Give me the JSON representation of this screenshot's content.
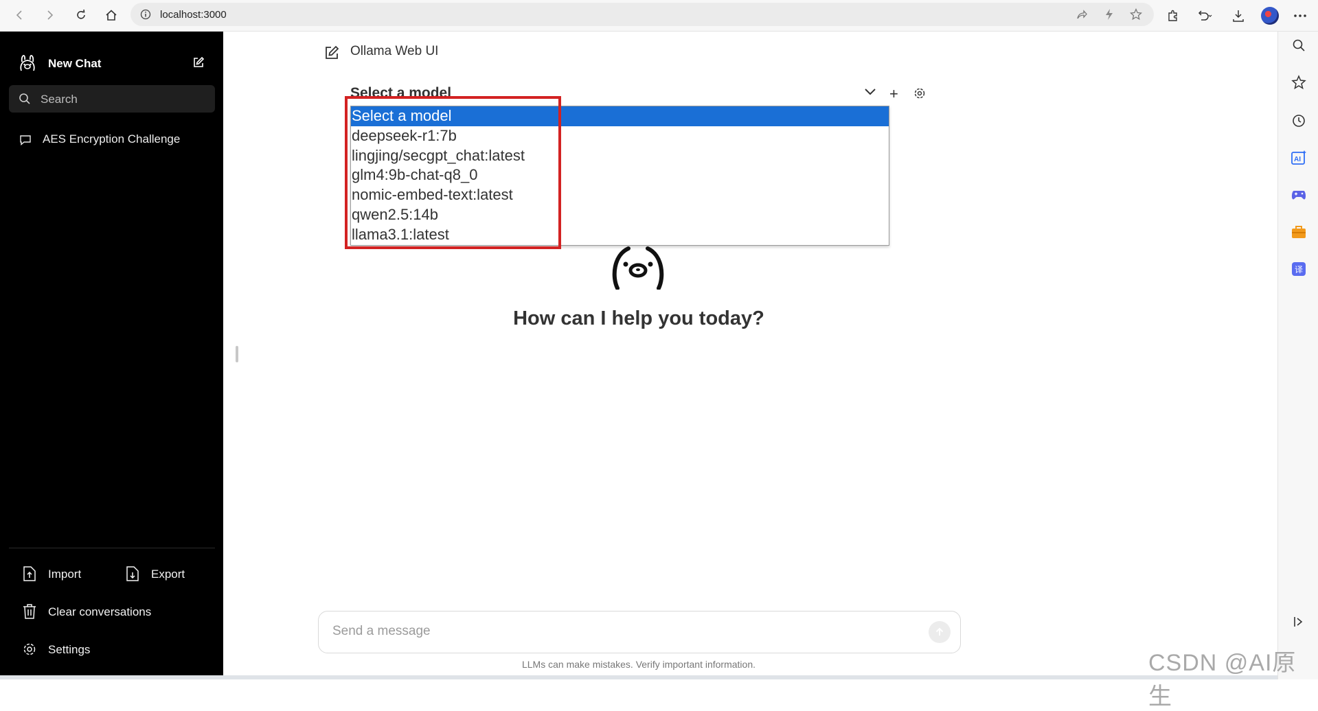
{
  "browser": {
    "url": "localhost:3000"
  },
  "sidebar": {
    "new_chat_label": "New Chat",
    "search_placeholder": "Search",
    "chats": [
      {
        "title": "AES Encryption Challenge"
      }
    ],
    "actions": {
      "import_label": "Import",
      "export_label": "Export",
      "clear_label": "Clear conversations",
      "settings_label": "Settings"
    }
  },
  "header": {
    "title": "Ollama Web UI"
  },
  "model_selector": {
    "current": "Select a model",
    "options": [
      "Select a model",
      "deepseek-r1:7b",
      "lingjing/secgpt_chat:latest",
      "glm4:9b-chat-q8_0",
      "nomic-embed-text:latest",
      "qwen2.5:14b",
      "llama3.1:latest"
    ],
    "selected_index": 0,
    "add_label": "+"
  },
  "main": {
    "welcome": "How can I help you today?",
    "message_placeholder": "Send a message",
    "disclaimer": "LLMs can make mistakes. Verify important information."
  },
  "watermark": "CSDN @AI原生",
  "colors": {
    "sidebar_bg": "#000000",
    "selected_option": "#1a6fd6",
    "highlight_border": "#d32222"
  }
}
